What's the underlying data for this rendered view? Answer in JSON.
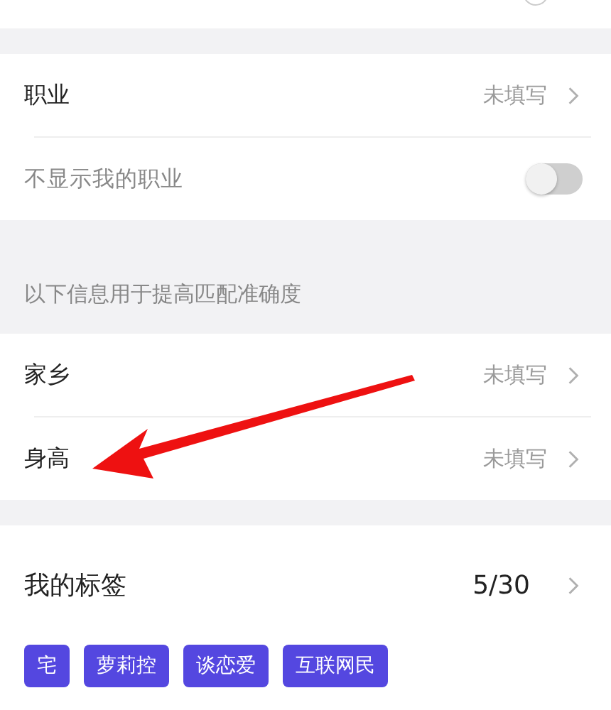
{
  "profile_section": {
    "rows": [
      {
        "kind": "link",
        "label": "职业",
        "value": "未填写"
      },
      {
        "kind": "toggle",
        "label": "不显示我的职业",
        "on": false
      }
    ]
  },
  "match_section": {
    "caption": "以下信息用于提高匹配准确度",
    "rows": [
      {
        "kind": "link",
        "label": "家乡",
        "value": "未填写"
      },
      {
        "kind": "link",
        "label": "身高",
        "value": "未填写"
      }
    ]
  },
  "tags_section": {
    "title": "我的标签",
    "count": "5/30",
    "tags": [
      "宅",
      "萝莉控",
      "谈恋爱",
      "互联网民"
    ]
  }
}
